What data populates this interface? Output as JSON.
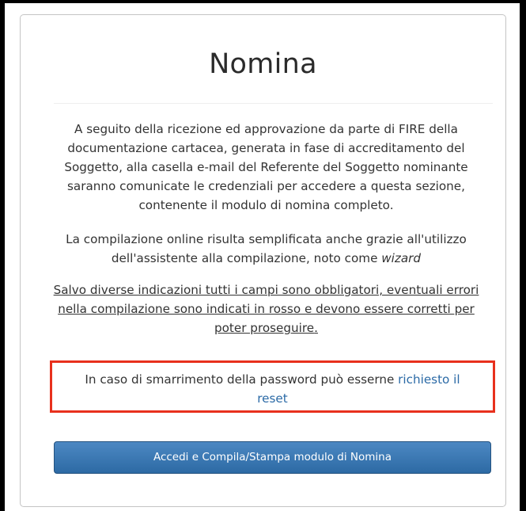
{
  "card": {
    "title": "Nomina",
    "paragraph1": "A seguito della ricezione ed approvazione da parte di FIRE della documentazione cartacea, generata in fase di accreditamento del Soggetto, alla casella e-mail del Referente del Soggetto nominante saranno comunicate le credenziali per accedere a questa sezione, contenente il modulo di nomina completo.",
    "paragraph2_text": "La compilazione online risulta semplificata anche grazie all'utilizzo dell'assistente alla compilazione, noto come",
    "paragraph2_emphasis": "wizard",
    "paragraph3": "Salvo diverse indicazioni tutti i campi sono obbligatori, eventuali errori nella compilazione sono indicati in rosso e devono essere corretti per poter proseguire",
    "paragraph3_end": ".",
    "reset_text": "In caso di smarrimento della password può esserne",
    "reset_link": "richiesto il reset",
    "button_label": "Accedi e Compila/Stampa modulo di Nomina"
  },
  "colors": {
    "highlight_border": "#e8301d",
    "link": "#2b6aa6",
    "button": "#3a78b5"
  }
}
